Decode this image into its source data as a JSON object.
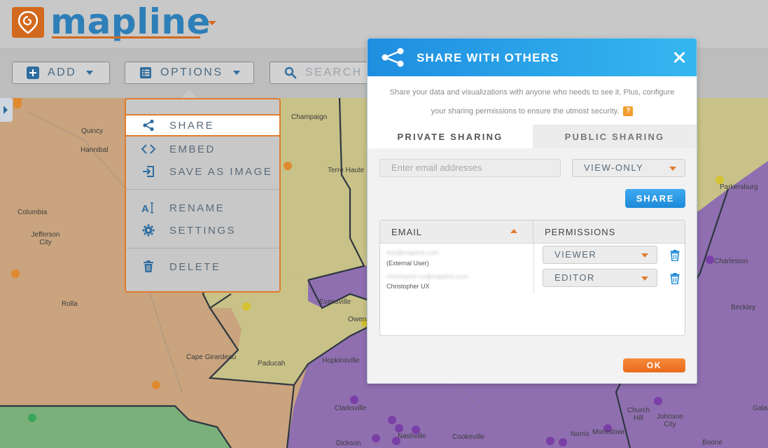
{
  "app": {
    "logo_text": "mapline"
  },
  "toolbar": {
    "add_label": "ADD",
    "options_label": "OPTIONS",
    "search_placeholder": "SEARCH"
  },
  "options_menu": {
    "items": [
      {
        "label": "SHARE",
        "icon": "share-icon",
        "active": true
      },
      {
        "label": "EMBED",
        "icon": "code-icon"
      },
      {
        "label": "SAVE AS IMAGE",
        "icon": "export-icon"
      },
      {
        "label": "RENAME",
        "icon": "text-cursor-icon"
      },
      {
        "label": "SETTINGS",
        "icon": "gear-icon"
      },
      {
        "label": "DELETE",
        "icon": "trash-icon"
      }
    ]
  },
  "map": {
    "labels": [
      {
        "text": "Quincy"
      },
      {
        "text": "Hannibal"
      },
      {
        "text": "Columbia"
      },
      {
        "text": "Jefferson City"
      },
      {
        "text": "Rolla"
      },
      {
        "text": "Cape Girardeau"
      },
      {
        "text": "Paducah"
      },
      {
        "text": "Hopkinsville"
      },
      {
        "text": "Clarksville"
      },
      {
        "text": "Nashville"
      },
      {
        "text": "Cookeville"
      },
      {
        "text": "Dickson"
      },
      {
        "text": "Terre Haute"
      },
      {
        "text": "Champaign"
      },
      {
        "text": "Owensboro"
      },
      {
        "text": "Evansville"
      },
      {
        "text": "Parkersburg"
      },
      {
        "text": "Charleston"
      },
      {
        "text": "Beckley"
      },
      {
        "text": "Church Hill"
      },
      {
        "text": "Johnson City"
      },
      {
        "text": "Norris"
      },
      {
        "text": "Morristown"
      },
      {
        "text": "Boone"
      },
      {
        "text": "Galax"
      }
    ],
    "colors": {
      "missouri": "#c9a47e",
      "illinois": "#c8c288",
      "kentucky": "#c8c288",
      "tennessee": "#8f6fb0",
      "arkansas": "#7bb07a",
      "westvirginia": "#8f6fb0"
    }
  },
  "modal": {
    "title": "SHARE WITH OTHERS",
    "description_line1": "Share your data and visualizations with anyone who needs to see it. Plus, configure",
    "description_line2": "your sharing permissions to ensure the utmost security.",
    "help_label": "?",
    "tabs": [
      {
        "label": "PRIVATE SHARING",
        "active": true
      },
      {
        "label": "PUBLIC SHARING",
        "active": false
      }
    ],
    "email_placeholder": "Enter email addresses",
    "permission_selected": "VIEW-ONLY",
    "share_button": "SHARE",
    "table": {
      "headers": {
        "email": "EMAIL",
        "permissions": "PERMISSIONS"
      },
      "rows": [
        {
          "email": "test@mapline.com",
          "name": "(External User)",
          "permission": "VIEWER"
        },
        {
          "email": "christopher.ux@mapline.com",
          "name": "Christopher UX",
          "permission": "EDITOR"
        }
      ]
    },
    "ok_button": "OK"
  }
}
